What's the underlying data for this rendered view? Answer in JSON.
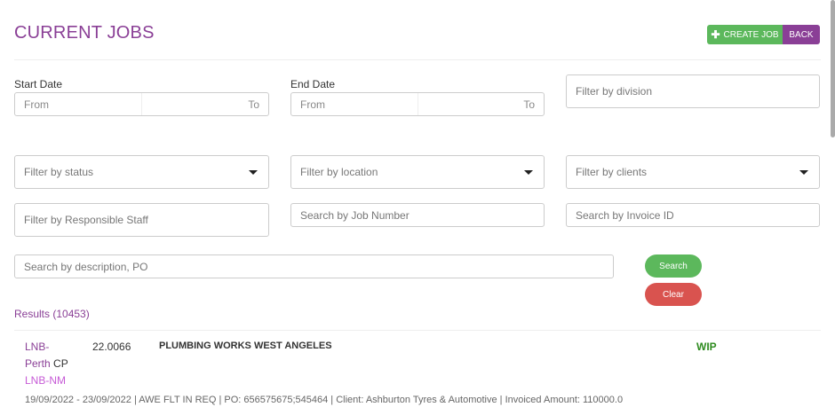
{
  "header": {
    "title": "CURRENT JOBS",
    "create_label": "CREATE JOB",
    "back_label": "BACK"
  },
  "filters": {
    "start_date_label": "Start Date",
    "end_date_label": "End Date",
    "from_placeholder": "From",
    "to_placeholder": "To",
    "division_placeholder": "Filter by division",
    "status_placeholder": "Filter by status",
    "location_placeholder": "Filter by location",
    "clients_placeholder": "Filter by clients",
    "staff_placeholder": "Filter by Responsible Staff",
    "job_number_placeholder": "Search by Job Number",
    "invoice_placeholder": "Search by Invoice ID",
    "description_placeholder": "Search by description, PO",
    "search_label": "Search",
    "clear_label": "Clear"
  },
  "results": {
    "label": "Results (10453)"
  },
  "jobs": [
    {
      "location_line1": "LNB-",
      "location_line2": "Perth",
      "location_suffix": " CP",
      "sub": "LNB-NM",
      "number": "22.0066",
      "title": "PLUMBING WORKS WEST ANGELES",
      "status": "WIP",
      "meta": "19/09/2022 - 23/09/2022 |  AWE FLT IN REQ | PO: 656575675;545464 |  Client: Ashburton Tyres & Automotive | Invoiced Amount: 110000.0"
    }
  ],
  "colors": {
    "brand": "#8a3f96",
    "success": "#5cb85c",
    "danger": "#d9534f",
    "status_wip": "#2e8b1f"
  }
}
